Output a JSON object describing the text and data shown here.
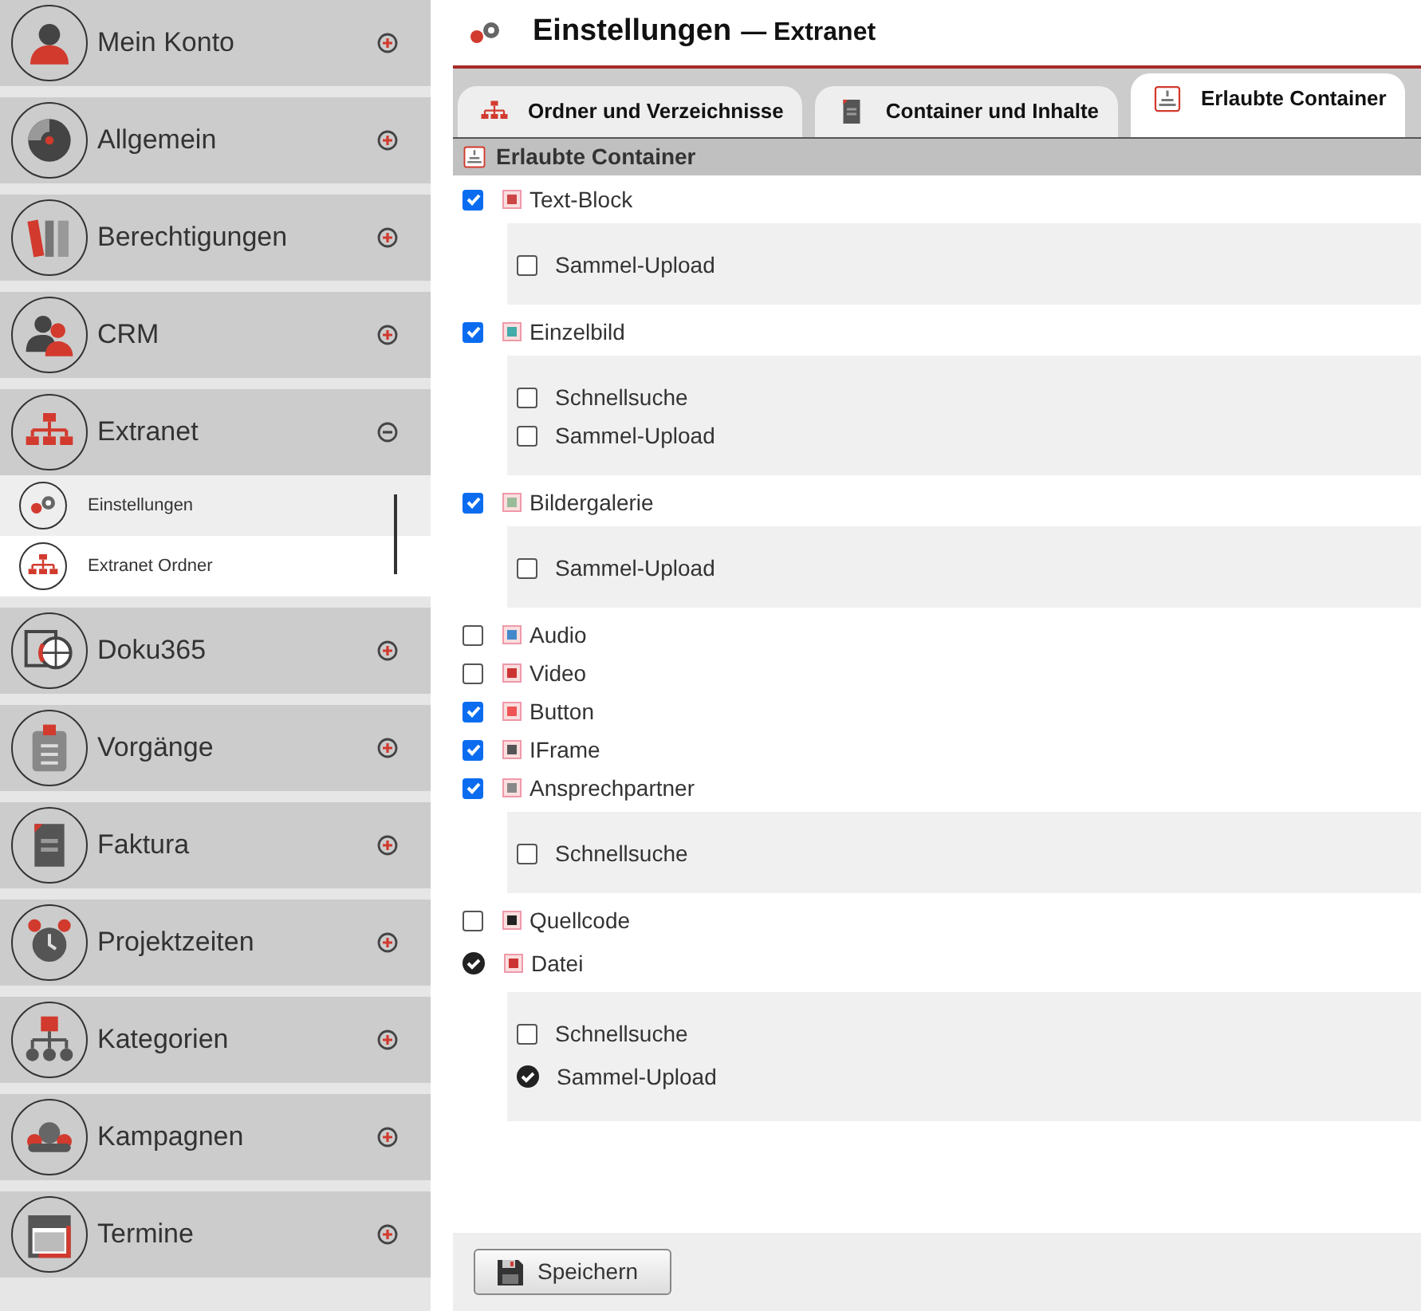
{
  "sidebar": {
    "items": [
      {
        "label": "Mein Konto",
        "kind": "person",
        "expanded": false
      },
      {
        "label": "Allgemein",
        "kind": "disc",
        "expanded": false
      },
      {
        "label": "Berechtigungen",
        "kind": "books",
        "expanded": false
      },
      {
        "label": "CRM",
        "kind": "people",
        "expanded": false
      },
      {
        "label": "Extranet",
        "kind": "orgchart",
        "expanded": true,
        "children": [
          {
            "label": "Einstellungen",
            "kind": "gears",
            "selected": true
          },
          {
            "label": "Extranet Ordner",
            "kind": "orgchart",
            "selected": false
          }
        ]
      },
      {
        "label": "Doku365",
        "kind": "globe",
        "expanded": false
      },
      {
        "label": "Vorgänge",
        "kind": "clipboard",
        "expanded": false
      },
      {
        "label": "Faktura",
        "kind": "document",
        "expanded": false
      },
      {
        "label": "Projektzeiten",
        "kind": "alarm",
        "expanded": false
      },
      {
        "label": "Kategorien",
        "kind": "tree",
        "expanded": false
      },
      {
        "label": "Kampagnen",
        "kind": "group",
        "expanded": false
      },
      {
        "label": "Termine",
        "kind": "calendar",
        "expanded": false
      }
    ]
  },
  "header": {
    "title": "Einstellungen",
    "context": "— Extranet"
  },
  "tabs": [
    {
      "label": "Ordner und Verzeichnisse",
      "kind": "orgchart",
      "selected": false
    },
    {
      "label": "Container und Inhalte",
      "kind": "document",
      "selected": false
    },
    {
      "label": "Erlaubte Container",
      "kind": "container",
      "selected": true
    }
  ],
  "section": {
    "title": "Erlaubte Container"
  },
  "containers": [
    {
      "label": "Text-Block",
      "kind": "checkbox",
      "checked": true,
      "options": [
        {
          "label": "Sammel-Upload",
          "kind": "checkbox",
          "checked": false
        }
      ]
    },
    {
      "label": "Einzelbild",
      "kind": "checkbox",
      "checked": true,
      "options": [
        {
          "label": "Schnellsuche",
          "kind": "checkbox",
          "checked": false
        },
        {
          "label": "Sammel-Upload",
          "kind": "checkbox",
          "checked": false
        }
      ]
    },
    {
      "label": "Bildergalerie",
      "kind": "checkbox",
      "checked": true,
      "options": [
        {
          "label": "Sammel-Upload",
          "kind": "checkbox",
          "checked": false
        }
      ]
    },
    {
      "label": "Audio",
      "kind": "checkbox",
      "checked": false
    },
    {
      "label": "Video",
      "kind": "checkbox",
      "checked": false
    },
    {
      "label": "Button",
      "kind": "checkbox",
      "checked": true
    },
    {
      "label": "IFrame",
      "kind": "checkbox",
      "checked": true
    },
    {
      "label": "Ansprechpartner",
      "kind": "checkbox",
      "checked": true,
      "options": [
        {
          "label": "Schnellsuche",
          "kind": "checkbox",
          "checked": false
        }
      ]
    },
    {
      "label": "Quellcode",
      "kind": "checkbox",
      "checked": false
    },
    {
      "label": "Datei",
      "kind": "fixed",
      "checked": true,
      "options": [
        {
          "label": "Schnellsuche",
          "kind": "checkbox",
          "checked": false
        },
        {
          "label": "Sammel-Upload",
          "kind": "fixed",
          "checked": true
        }
      ]
    }
  ],
  "save_button": {
    "label": "Speichern"
  }
}
